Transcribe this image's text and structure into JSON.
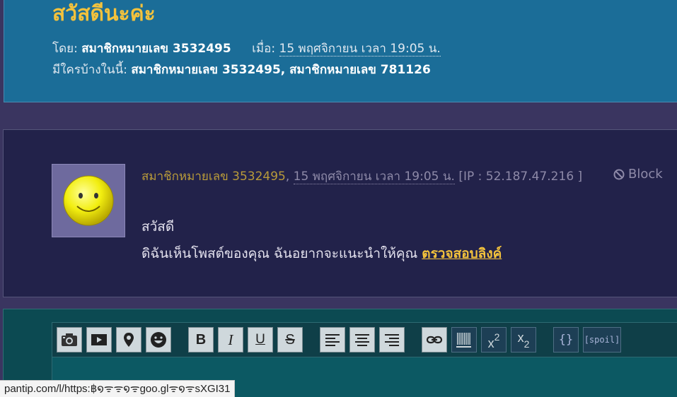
{
  "topic": {
    "title": "สวัสดีนะค่ะ",
    "by_label": "โดย:",
    "author": "สมาชิกหมายเลข 3532495",
    "date_label": "เมื่อ:",
    "date": "15 พฤศจิกายน เวลา 19:05 น.",
    "who_label": "มีใครบ้างในนี้:",
    "participants": "สมาชิกหมายเลข 3532495, สมาชิกหมายเลข 781126"
  },
  "comment": {
    "author": "สมาชิกหมายเลข 3532495",
    "separator": ",",
    "date": "15 พฤศจิกายน เวลา 19:05 น.",
    "ip": "[IP : 52.187.47.216 ]",
    "block_label": "Block",
    "greeting": "สวัสดี",
    "message": "ดิฉันเห็นโพสต์ของคุณ ฉันอยากจะแนะนำให้คุณ",
    "link_text": "ตรวจสอบลิงค์"
  },
  "toolbar": {
    "bold": "B",
    "italic": "I",
    "underline": "U",
    "strike": "S",
    "superscript_base": "x",
    "superscript_exp": "2",
    "subscript_base": "x",
    "subscript_exp": "2",
    "code": "{}",
    "spoil": "[spoil]"
  },
  "status_bar": {
    "url": "pantip.com/l/https:฿໑ᯤᯤ໑ᯤgoo.glᯤ໑ᯤsXGI31"
  },
  "colors": {
    "header_bg": "#1b6d98",
    "title": "#f3c23c",
    "comment_bg": "#22224a",
    "editor_bg": "#0c4a52"
  },
  "icons": {
    "avatar": "smiley-face",
    "block": "prohibited-icon",
    "photo": "camera-icon",
    "video": "play-icon",
    "location": "map-pin-icon",
    "emoticon": "smiley-icon",
    "align_left": "align-left-icon",
    "align_center": "align-center-icon",
    "align_right": "align-right-icon",
    "link": "link-icon",
    "hr": "barcode-icon"
  }
}
